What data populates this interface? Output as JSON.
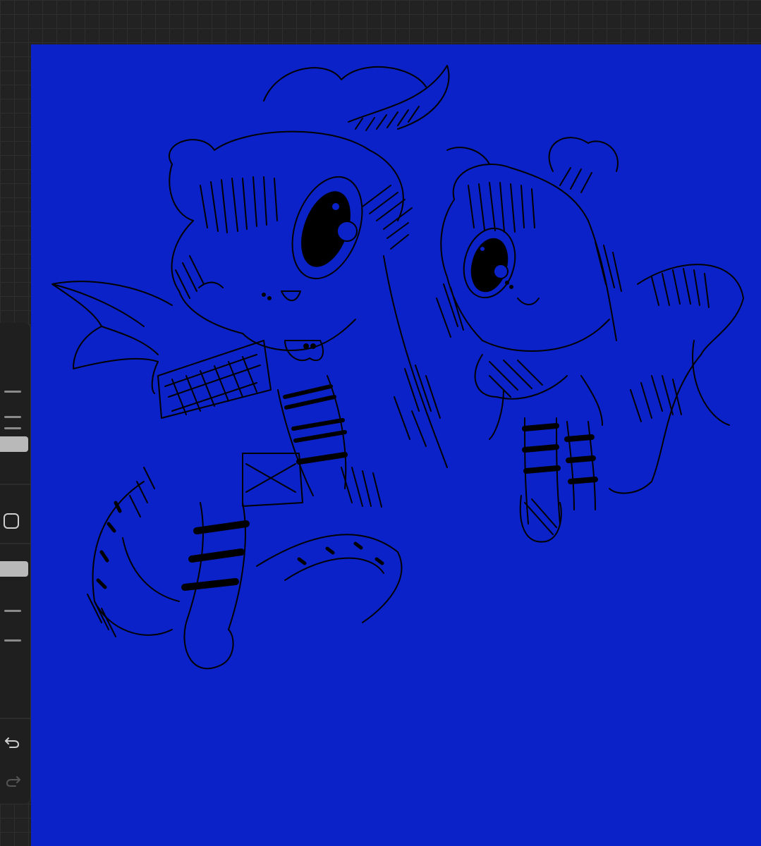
{
  "app": {
    "canvas_color": "#0a22c8",
    "sidebar_color": "#1f1f1f",
    "background_color": "#222222"
  },
  "sidebar": {
    "brush_size_slider": {
      "icon": "slider-thumb",
      "level": 0.3
    },
    "modify_button": {
      "icon": "square-icon"
    },
    "opacity_slider": {
      "icon": "slider-thumb",
      "level": 0.5
    },
    "undo": {
      "icon": "undo-icon"
    },
    "redo": {
      "icon": "redo-icon"
    }
  },
  "canvas": {
    "artwork": "ink sketch"
  }
}
